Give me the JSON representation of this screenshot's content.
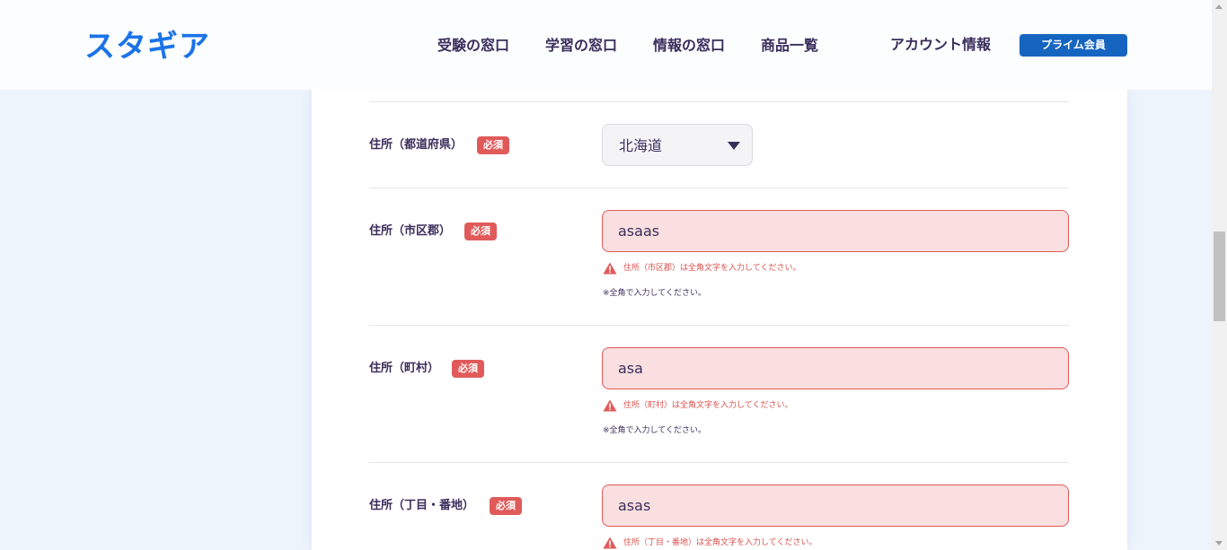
{
  "header": {
    "logo": "スタギア",
    "nav": [
      "受験の窓口",
      "学習の窓口",
      "情報の窓口",
      "商品一覧"
    ],
    "account_label": "アカウント情報",
    "prime_button": "プライム会員"
  },
  "form": {
    "required_badge": "必須",
    "prefecture": {
      "label": "住所（都道府県）",
      "value": "北海道"
    },
    "city": {
      "label": "住所（市区郡）",
      "value": "asaas",
      "error": "住所（市区郡）は全角文字を入力してください。",
      "note": "※全角で入力してください。"
    },
    "town": {
      "label": "住所（町村）",
      "value": "asa",
      "error": "住所（町村）は全角文字を入力してください。",
      "note": "※全角で入力してください。"
    },
    "block": {
      "label": "住所（丁目・番地）",
      "value": "asas",
      "error": "住所（丁目・番地）は全角文字を入力してください。"
    }
  },
  "colors": {
    "brand_blue": "#1a73e8",
    "prime_button": "#1565c0",
    "error_red": "#e05a5a",
    "error_field_bg": "#f9dfdf",
    "text_dark": "#3a2e5c"
  },
  "icons": [
    "warning-triangle-icon",
    "chevron-down-icon"
  ]
}
